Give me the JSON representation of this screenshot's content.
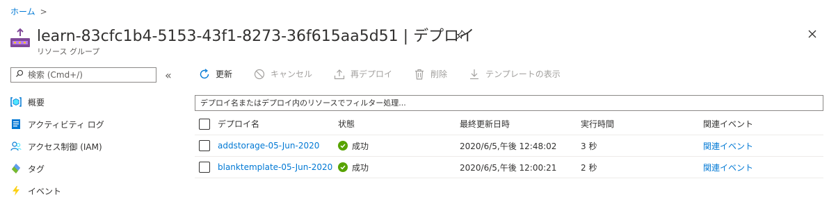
{
  "breadcrumb": {
    "home": "ホーム",
    "separator": ">"
  },
  "header": {
    "title": "learn-83cfc1b4-5153-43f1-8273-36f615aa5d51 | デプロイ",
    "subtitle": "リソース グループ",
    "icon": "resource-group-icon"
  },
  "sidebar": {
    "search_placeholder": "検索 (Cmd+/)",
    "collapse_label": "«",
    "items": [
      {
        "label": "概要",
        "icon": "overview-icon"
      },
      {
        "label": "アクティビティ ログ",
        "icon": "activity-log-icon"
      },
      {
        "label": "アクセス制御 (IAM)",
        "icon": "iam-icon"
      },
      {
        "label": "タグ",
        "icon": "tag-icon"
      },
      {
        "label": "イベント",
        "icon": "lightning-icon"
      }
    ]
  },
  "toolbar": {
    "refresh": "更新",
    "cancel": "キャンセル",
    "redeploy": "再デプロイ",
    "delete": "削除",
    "view_template": "テンプレートの表示"
  },
  "filter": {
    "placeholder": "デプロイ名またはデプロイ内のリソースでフィルター処理..."
  },
  "table": {
    "columns": {
      "name": "デプロイ名",
      "state": "状態",
      "last_modified": "最終更新日時",
      "duration": "実行時間",
      "events": "関連イベント"
    },
    "rows": [
      {
        "name": "addstorage-05-Jun-2020",
        "state": "成功",
        "last_modified": "2020/6/5,午後 12:48:02",
        "duration": "3 秒",
        "events": "関連イベント"
      },
      {
        "name": "blanktemplate-05-Jun-2020",
        "state": "成功",
        "last_modified": "2020/6/5,午後 12:00:21",
        "duration": "2 秒",
        "events": "関連イベント"
      }
    ]
  },
  "colors": {
    "accent": "#0078d4",
    "success": "#57a300",
    "disabled": "#a19f9d"
  }
}
